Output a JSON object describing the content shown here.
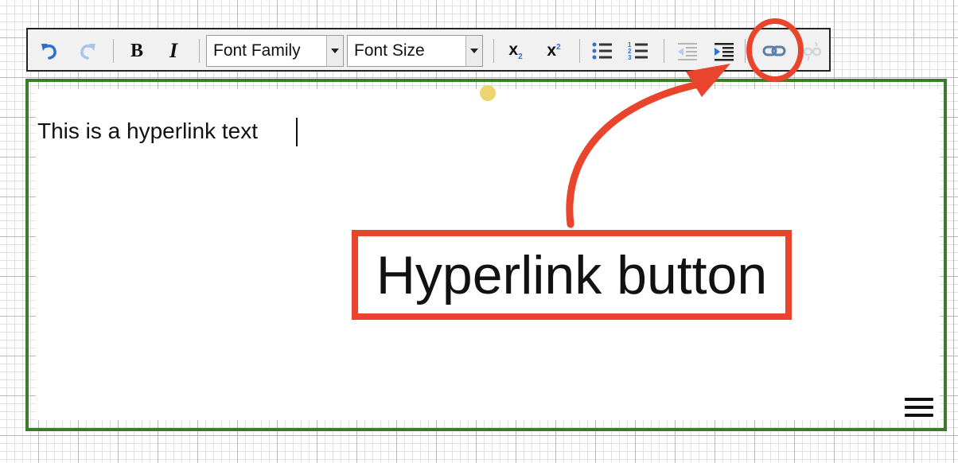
{
  "toolbar": {
    "font_family": "Font Family",
    "font_size": "Font Size"
  },
  "editor": {
    "text": "This is a hyperlink text"
  },
  "annotation": {
    "label": "Hyperlink button",
    "color": "#e8452c"
  },
  "colors": {
    "editor_border": "#3c7a2c",
    "selection_handle": "#ecd56e"
  },
  "icons": [
    "undo-icon",
    "redo-icon",
    "bold-icon",
    "italic-icon",
    "subscript-icon",
    "superscript-icon",
    "bulleted-list-icon",
    "numbered-list-icon",
    "outdent-icon",
    "indent-icon",
    "link-icon",
    "unlink-icon",
    "menu-icon"
  ]
}
